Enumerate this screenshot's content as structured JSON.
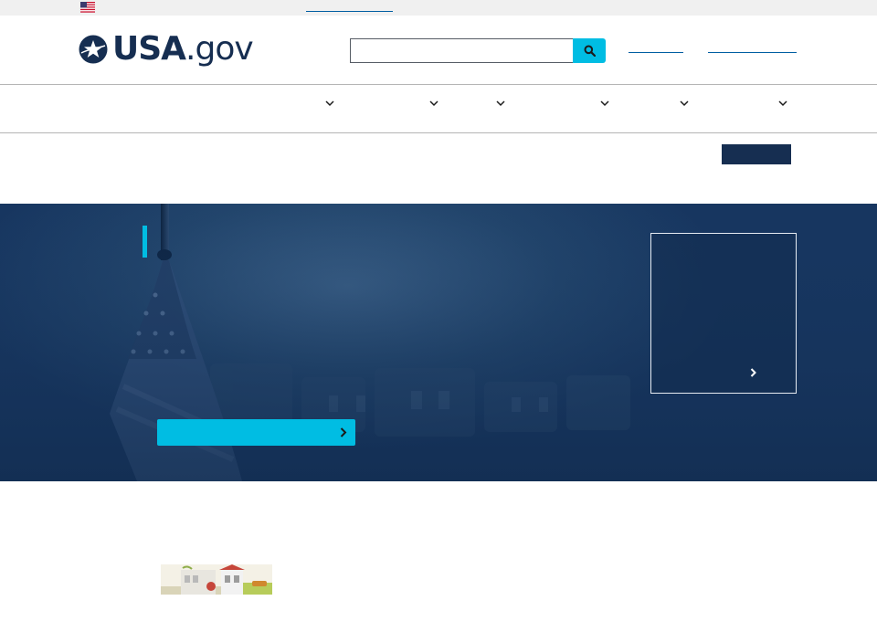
{
  "banner": {
    "flag_icon": "us-flag-icon",
    "link_text": ""
  },
  "header": {
    "logo_text": "USA",
    "logo_suffix": ".gov",
    "search": {
      "placeholder": "",
      "value": ""
    },
    "search_icon": "search-icon",
    "links": [
      "",
      ""
    ]
  },
  "nav": {
    "items": [
      {
        "label": "",
        "icon": "chevron-down-icon"
      },
      {
        "label": "",
        "icon": "chevron-down-icon"
      },
      {
        "label": "",
        "icon": "chevron-down-icon"
      },
      {
        "label": "",
        "icon": "chevron-down-icon"
      },
      {
        "label": "",
        "icon": "chevron-down-icon"
      },
      {
        "label": "",
        "icon": "chevron-down-icon"
      }
    ]
  },
  "subheader": {
    "action_label": ""
  },
  "hero": {
    "title": "",
    "cta_label": "",
    "card": {
      "title": "",
      "link_label": ""
    }
  },
  "colors": {
    "brand_navy": "#162e51",
    "accent_cyan": "#00bde3",
    "link_blue": "#005ea2",
    "banner_gray": "#f0f0f0"
  }
}
